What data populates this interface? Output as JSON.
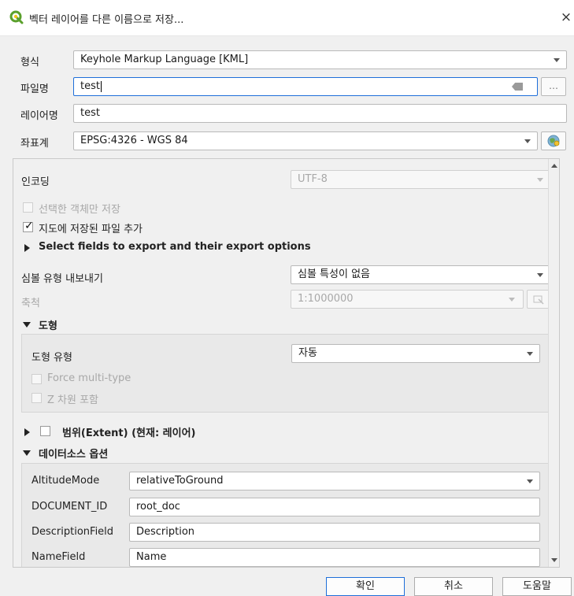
{
  "window": {
    "title": "벡터 레이어를 다른 이름으로 저장...",
    "close": "×"
  },
  "form": {
    "format_label": "형식",
    "format_value": "Keyhole Markup Language [KML]",
    "filename_label": "파일명",
    "filename_value": "test",
    "browse_label": "…",
    "layername_label": "레이어명",
    "layername_value": "test",
    "crs_label": "좌표계",
    "crs_value": "EPSG:4326 - WGS 84"
  },
  "options": {
    "encoding_label": "인코딩",
    "encoding_value": "UTF-8",
    "selected_only_label": "선택한 객체만 저장",
    "add_to_map_label": "지도에 저장된 파일 추가",
    "select_fields_label": "Select fields to export and their export options",
    "symbology_label": "심볼 유형 내보내기",
    "symbology_value": "심볼 특성이 없음",
    "scale_label": "축척",
    "scale_value": "1:1000000"
  },
  "geometry": {
    "header": "도형",
    "type_label": "도형 유형",
    "type_value": "자동",
    "force_multi_label": "Force multi-type",
    "z_dim_label": "Z 차원 포함"
  },
  "extent": {
    "header": "범위(Extent) (현재: 레이어)"
  },
  "datasource": {
    "header": "데이터소스 옵션",
    "rows": [
      {
        "label": "AltitudeMode",
        "value": "relativeToGround"
      },
      {
        "label": "DOCUMENT_ID",
        "value": "root_doc"
      },
      {
        "label": "DescriptionField",
        "value": "Description"
      },
      {
        "label": "NameField",
        "value": "Name"
      }
    ]
  },
  "footer": {
    "ok": "확인",
    "cancel": "취소",
    "help": "도움말"
  },
  "colors": {
    "accent": "#1e6fd9",
    "qgis_green": "#5aa02c"
  }
}
